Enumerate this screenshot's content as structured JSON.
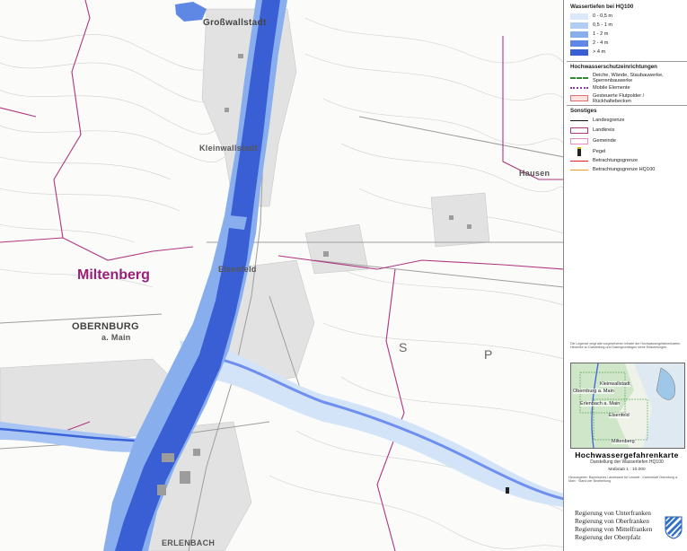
{
  "map": {
    "district_label": "Miltenberg",
    "places": [
      {
        "id": "grosswallstadt",
        "text": "Großwallstadt"
      },
      {
        "id": "kleinwallstadt",
        "text": "Kleinwallstadt"
      },
      {
        "id": "elsenfeld",
        "text": "Elsenfeld"
      },
      {
        "id": "obernburg",
        "text": "OBERNBURG"
      },
      {
        "id": "obernburg_sub",
        "text": "a. Main"
      },
      {
        "id": "hausen",
        "text": "Hausen"
      },
      {
        "id": "erlenbach",
        "text": "ERLENBACH"
      }
    ],
    "letters": [
      "S",
      "P"
    ],
    "colors": {
      "river_deep": "#3a63d8",
      "river_mid": "#6f8ff0",
      "river_shallow": "#a9c5f3",
      "river_veryshallow": "#d3e4f8",
      "district_boundary": "#b0357f",
      "contour": "#c8c8c8",
      "road": "#bdbdbd"
    }
  },
  "legend": {
    "depths_title": "Wassertiefen bei HQ100",
    "depths": [
      {
        "label": "0 - 0,5 m",
        "color": "#d9e8fa"
      },
      {
        "label": "0,5 - 1 m",
        "color": "#b2cdf4"
      },
      {
        "label": "1 - 2 m",
        "color": "#89aeee"
      },
      {
        "label": "2 - 4 m",
        "color": "#5f87e4"
      },
      {
        "label": "> 4 m",
        "color": "#3a5fd4"
      }
    ],
    "protection_title": "Hochwasserschutzeinrichtungen",
    "protection": [
      {
        "label": "Deiche, Wände, Staubauwerke, Sperrenbauwerke",
        "kind": "dashed-green"
      },
      {
        "label": "Mobile Elemente",
        "kind": "dots-purple"
      },
      {
        "label": "Gesteuerte Flutpolder / Rückhaltebecken",
        "kind": "pink-box"
      }
    ],
    "other_title": "Sonstiges",
    "other": [
      {
        "label": "Landesgrenze",
        "kind": "line-black"
      },
      {
        "label": "Landkreis",
        "kind": "box-magenta"
      },
      {
        "label": "Gemeinde",
        "kind": "box-pink"
      },
      {
        "label": "Pegel",
        "kind": "gauge"
      },
      {
        "label": "Betrachtungsgrenze",
        "kind": "line-red"
      },
      {
        "label": "Betrachtungsgrenze HQ100",
        "kind": "line-orange"
      }
    ],
    "notes": "Die Legende zeigt alle vorgesehenen Inhalte der Hochwassergefahrenkarten. Hinweise zu Darstellung und Datengrundlagen siehe Erläuterungen.",
    "overview_labels": [
      "Kleinwallstadt",
      "Obernburg a. Main",
      "Erlenbach a. Main",
      "Elsenfeld",
      "Miltenberg"
    ]
  },
  "title_block": {
    "title": "Hochwassergefahrenkarte",
    "subtitle": "Darstellung der Wassertiefen HQ100",
    "scale": "Maßstab 1 : 10.000",
    "meta": "Herausgeber: Bayerisches Landesamt für Umwelt · Kartenblatt Obernburg a. Main · Stand der Bearbeitung"
  },
  "authority": {
    "lines": [
      "Regierung von Unterfranken",
      "Regierung von Oberfranken",
      "Regierung von Mittelfranken",
      "Regierung der Oberpfalz"
    ]
  }
}
